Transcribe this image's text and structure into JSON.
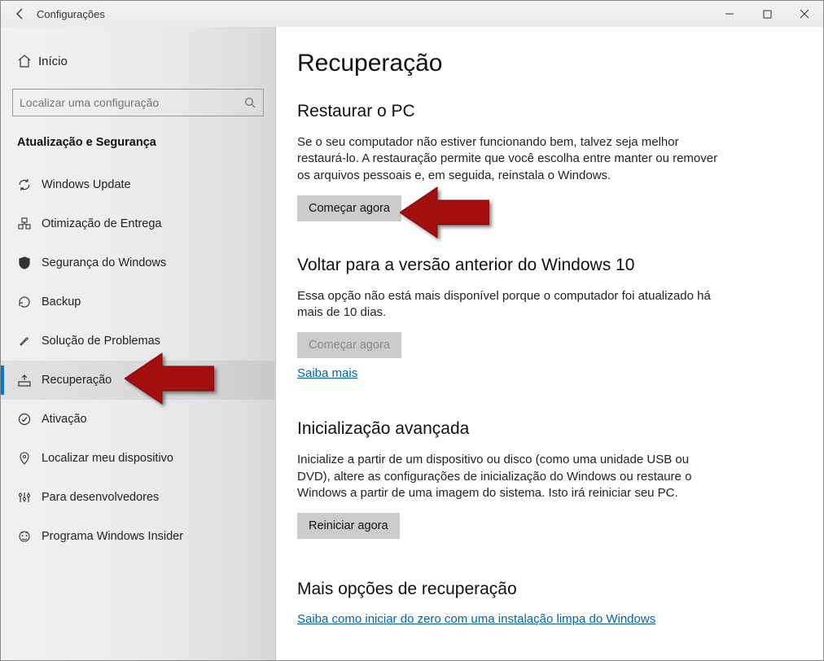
{
  "titlebar": {
    "title": "Configurações"
  },
  "sidebar": {
    "home": "Início",
    "search_placeholder": "Localizar uma configuração",
    "section": "Atualização e Segurança",
    "items": [
      {
        "id": "windows-update",
        "label": "Windows Update"
      },
      {
        "id": "delivery-opt",
        "label": "Otimização de Entrega"
      },
      {
        "id": "windows-security",
        "label": "Segurança do Windows"
      },
      {
        "id": "backup",
        "label": "Backup"
      },
      {
        "id": "troubleshoot",
        "label": "Solução de Problemas"
      },
      {
        "id": "recovery",
        "label": "Recuperação"
      },
      {
        "id": "activation",
        "label": "Ativação"
      },
      {
        "id": "find-device",
        "label": "Localizar meu dispositivo"
      },
      {
        "id": "developers",
        "label": "Para desenvolvedores"
      },
      {
        "id": "insider",
        "label": "Programa Windows Insider"
      }
    ]
  },
  "main": {
    "page_title": "Recuperação",
    "reset": {
      "heading": "Restaurar o PC",
      "body": "Se o seu computador não estiver funcionando bem, talvez seja melhor restaurá-lo. A restauração permite que você escolha entre manter ou remover os arquivos pessoais e, em seguida, reinstala o Windows.",
      "button": "Começar agora"
    },
    "goback": {
      "heading": "Voltar para a versão anterior do Windows 10",
      "body": "Essa opção não está mais disponível porque o computador foi atualizado há mais de 10 dias.",
      "button": "Começar agora",
      "link": "Saiba mais"
    },
    "advanced": {
      "heading": "Inicialização avançada",
      "body": "Inicialize a partir de um dispositivo ou disco (como uma unidade USB ou DVD), altere as configurações de inicialização do Windows ou restaure o Windows a partir de uma imagem do sistema. Isto irá reiniciar seu PC.",
      "button": "Reiniciar agora"
    },
    "more": {
      "heading": "Mais opções de recuperação",
      "link": "Saiba como iniciar do zero com uma instalação limpa do Windows"
    }
  }
}
